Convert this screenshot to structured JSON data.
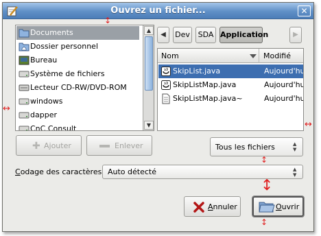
{
  "dialog": {
    "title": "Ouvrez un fichier...",
    "close_symbol": "✕"
  },
  "places": {
    "items": [
      {
        "label": "Documents",
        "icon": "folder-icon",
        "selected": true
      },
      {
        "label": "Dossier personnel",
        "icon": "home-folder-icon",
        "selected": false
      },
      {
        "label": "Bureau",
        "icon": "desktop-icon",
        "selected": false
      },
      {
        "label": "Système de fichiers",
        "icon": "drive-icon",
        "selected": false
      },
      {
        "label": "Lecteur CD-RW/DVD-ROM",
        "icon": "optical-drive-icon",
        "selected": false
      },
      {
        "label": "windows",
        "icon": "drive-icon",
        "selected": false
      },
      {
        "label": "dapper",
        "icon": "drive-icon",
        "selected": false
      },
      {
        "label": "CnC Consult",
        "icon": "drive-icon",
        "selected": false
      }
    ],
    "add_label": "Ajouter",
    "remove_label": "Enlever"
  },
  "breadcrumb": {
    "back_symbol": "◀",
    "forward_symbol": "▶",
    "items": [
      {
        "label": "Dev",
        "active": false
      },
      {
        "label": "SDA",
        "active": false
      },
      {
        "label": "Application",
        "active": true
      }
    ]
  },
  "files": {
    "columns": {
      "name": "Nom",
      "modified": "Modifié"
    },
    "rows": [
      {
        "name": "SkipList.java",
        "modified": "Aujourd'hui",
        "icon": "java-file-icon",
        "selected": true
      },
      {
        "name": "SkipListMap.java",
        "modified": "Aujourd'hui",
        "icon": "java-file-icon",
        "selected": false
      },
      {
        "name": "SkipListMap.java~",
        "modified": "Aujourd'hui",
        "icon": "text-file-icon",
        "selected": false
      }
    ]
  },
  "filter": {
    "selected": "Tous les fichiers"
  },
  "encoding": {
    "label_first": "C",
    "label_rest": "odage des caractères :",
    "selected": "Auto détecté"
  },
  "actions": {
    "cancel_first": "A",
    "cancel_rest": "nnuler",
    "open_first": "O",
    "open_rest": "uvrir"
  },
  "colors": {
    "titlebar": "#5f8fc6",
    "selection": "#3d6eb0",
    "markers": "#e02020"
  }
}
